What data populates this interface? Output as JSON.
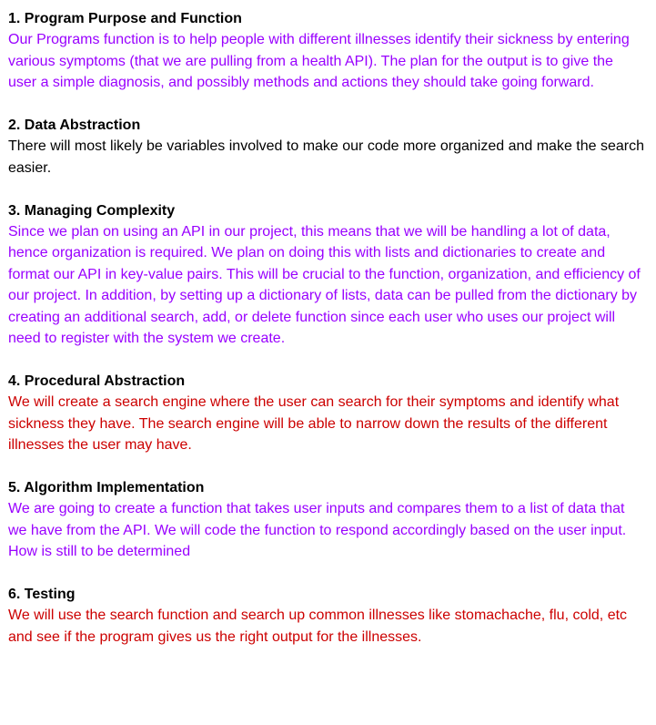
{
  "sections": [
    {
      "heading": "1. Program Purpose and Function",
      "body": "Our Programs function is to help people with different illnesses identify their sickness by entering various symptoms (that we are pulling from a health API). The plan for the output is to give the user a simple diagnosis, and possibly methods and actions they should take going forward.",
      "color": "#9900ff"
    },
    {
      "heading": "2. Data Abstraction",
      "body": "There will most likely be variables involved to make our code more organized and make the search easier.",
      "color": "#000000"
    },
    {
      "heading": "3. Managing Complexity",
      "body": "Since we plan on using an API in our project, this means that we will be handling a lot of data, hence organization is required. We plan on doing this with lists and dictionaries to create and format our API in key-value pairs. This will be crucial to the function, organization, and efficiency of our project. In addition, by setting up a dictionary of lists, data can be pulled from the dictionary by creating an additional search, add, or delete function since each user who uses our project will need to register with the system we create.",
      "color": "#9900ff"
    },
    {
      "heading": "4. Procedural Abstraction",
      "body": "We will create a search engine where the user can search for their symptoms and identify what sickness they have. The search engine will be able to narrow down the results of the different illnesses the user may have.",
      "color": "#cc0000"
    },
    {
      "heading": "5. Algorithm Implementation",
      "body": "We are going to create a function that takes user inputs and compares them to a list of data that we have from the API. We will code the function to respond accordingly based on the user input. How is still to be determined",
      "color": "#9900ff"
    },
    {
      "heading": "6. Testing",
      "body": "We will use the search function and search up common illnesses like stomachache, flu, cold, etc and see if the program gives us the right output for the illnesses.",
      "color": "#cc0000"
    }
  ]
}
